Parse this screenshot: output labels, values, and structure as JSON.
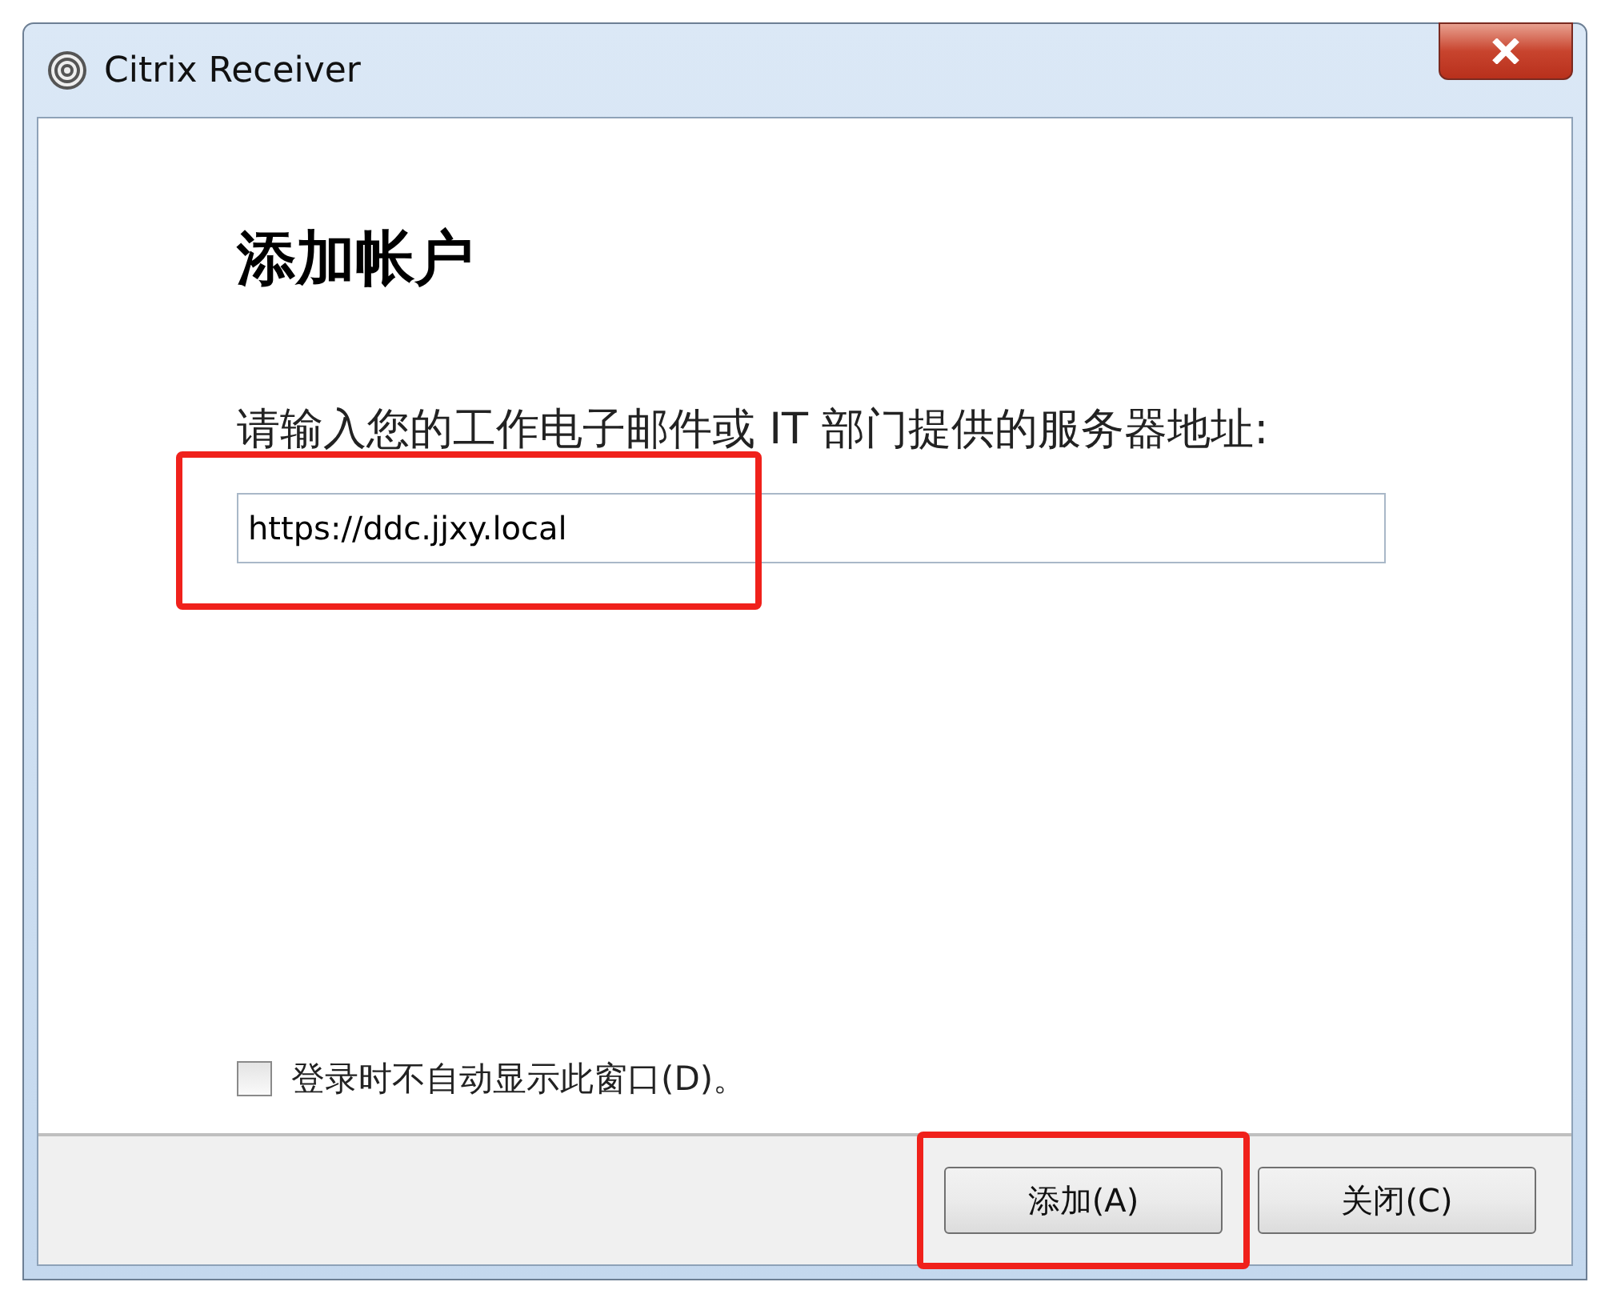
{
  "window": {
    "title": "Citrix Receiver"
  },
  "heading": "添加帐户",
  "prompt": "请输入您的工作电子邮件或 IT 部门提供的服务器地址:",
  "address_field": {
    "value": "https://ddc.jjxy.local",
    "highlighted": true
  },
  "dont_show_checkbox": {
    "label": "登录时不自动显示此窗口(D)。",
    "checked": false
  },
  "buttons": [
    {
      "label": "添加(A)",
      "highlighted": true
    },
    {
      "label": "关闭(C)",
      "highlighted": false
    }
  ]
}
